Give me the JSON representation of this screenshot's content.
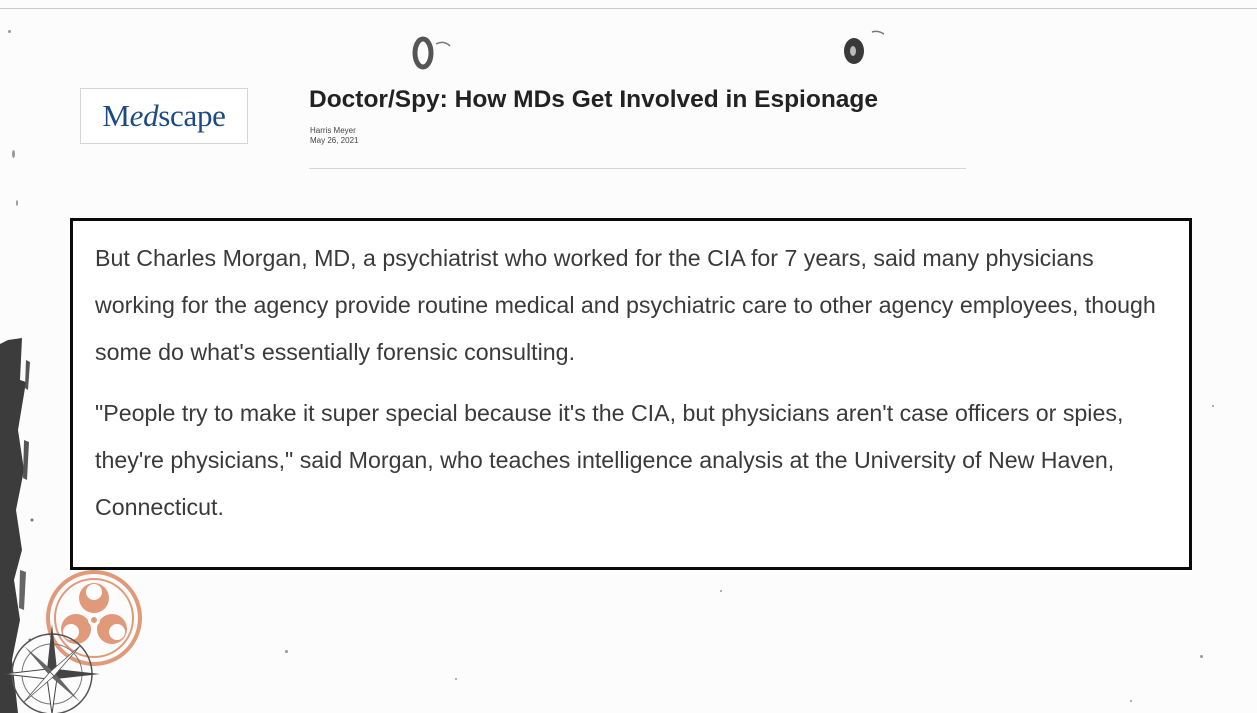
{
  "article": {
    "logo_text": "Medscape",
    "logo_parts": [
      "M",
      "ed",
      "scape"
    ],
    "title": "Doctor/Spy: How MDs Get Involved in Espionage",
    "author": "Harris Meyer",
    "date": "May 26, 2021"
  },
  "quote": {
    "paragraphs": [
      "But Charles Morgan, MD, a psychiatrist who worked for the CIA for 7 years, said many physicians working for the agency provide routine medical and psychiatric care to other agency employees, though some do what's essentially forensic consulting.",
      "\"People try to make it super special because it's the CIA, but physicians aren't case officers or spies, they're physicians,\" said Morgan, who teaches intelligence analysis at the University of New Haven, Connecticut."
    ]
  },
  "decor": {
    "biohazard_color": "#e09a7a",
    "compass_color": "#555555",
    "grunge_color": "#3c3c3c",
    "logo_color": "#1c4a84"
  }
}
